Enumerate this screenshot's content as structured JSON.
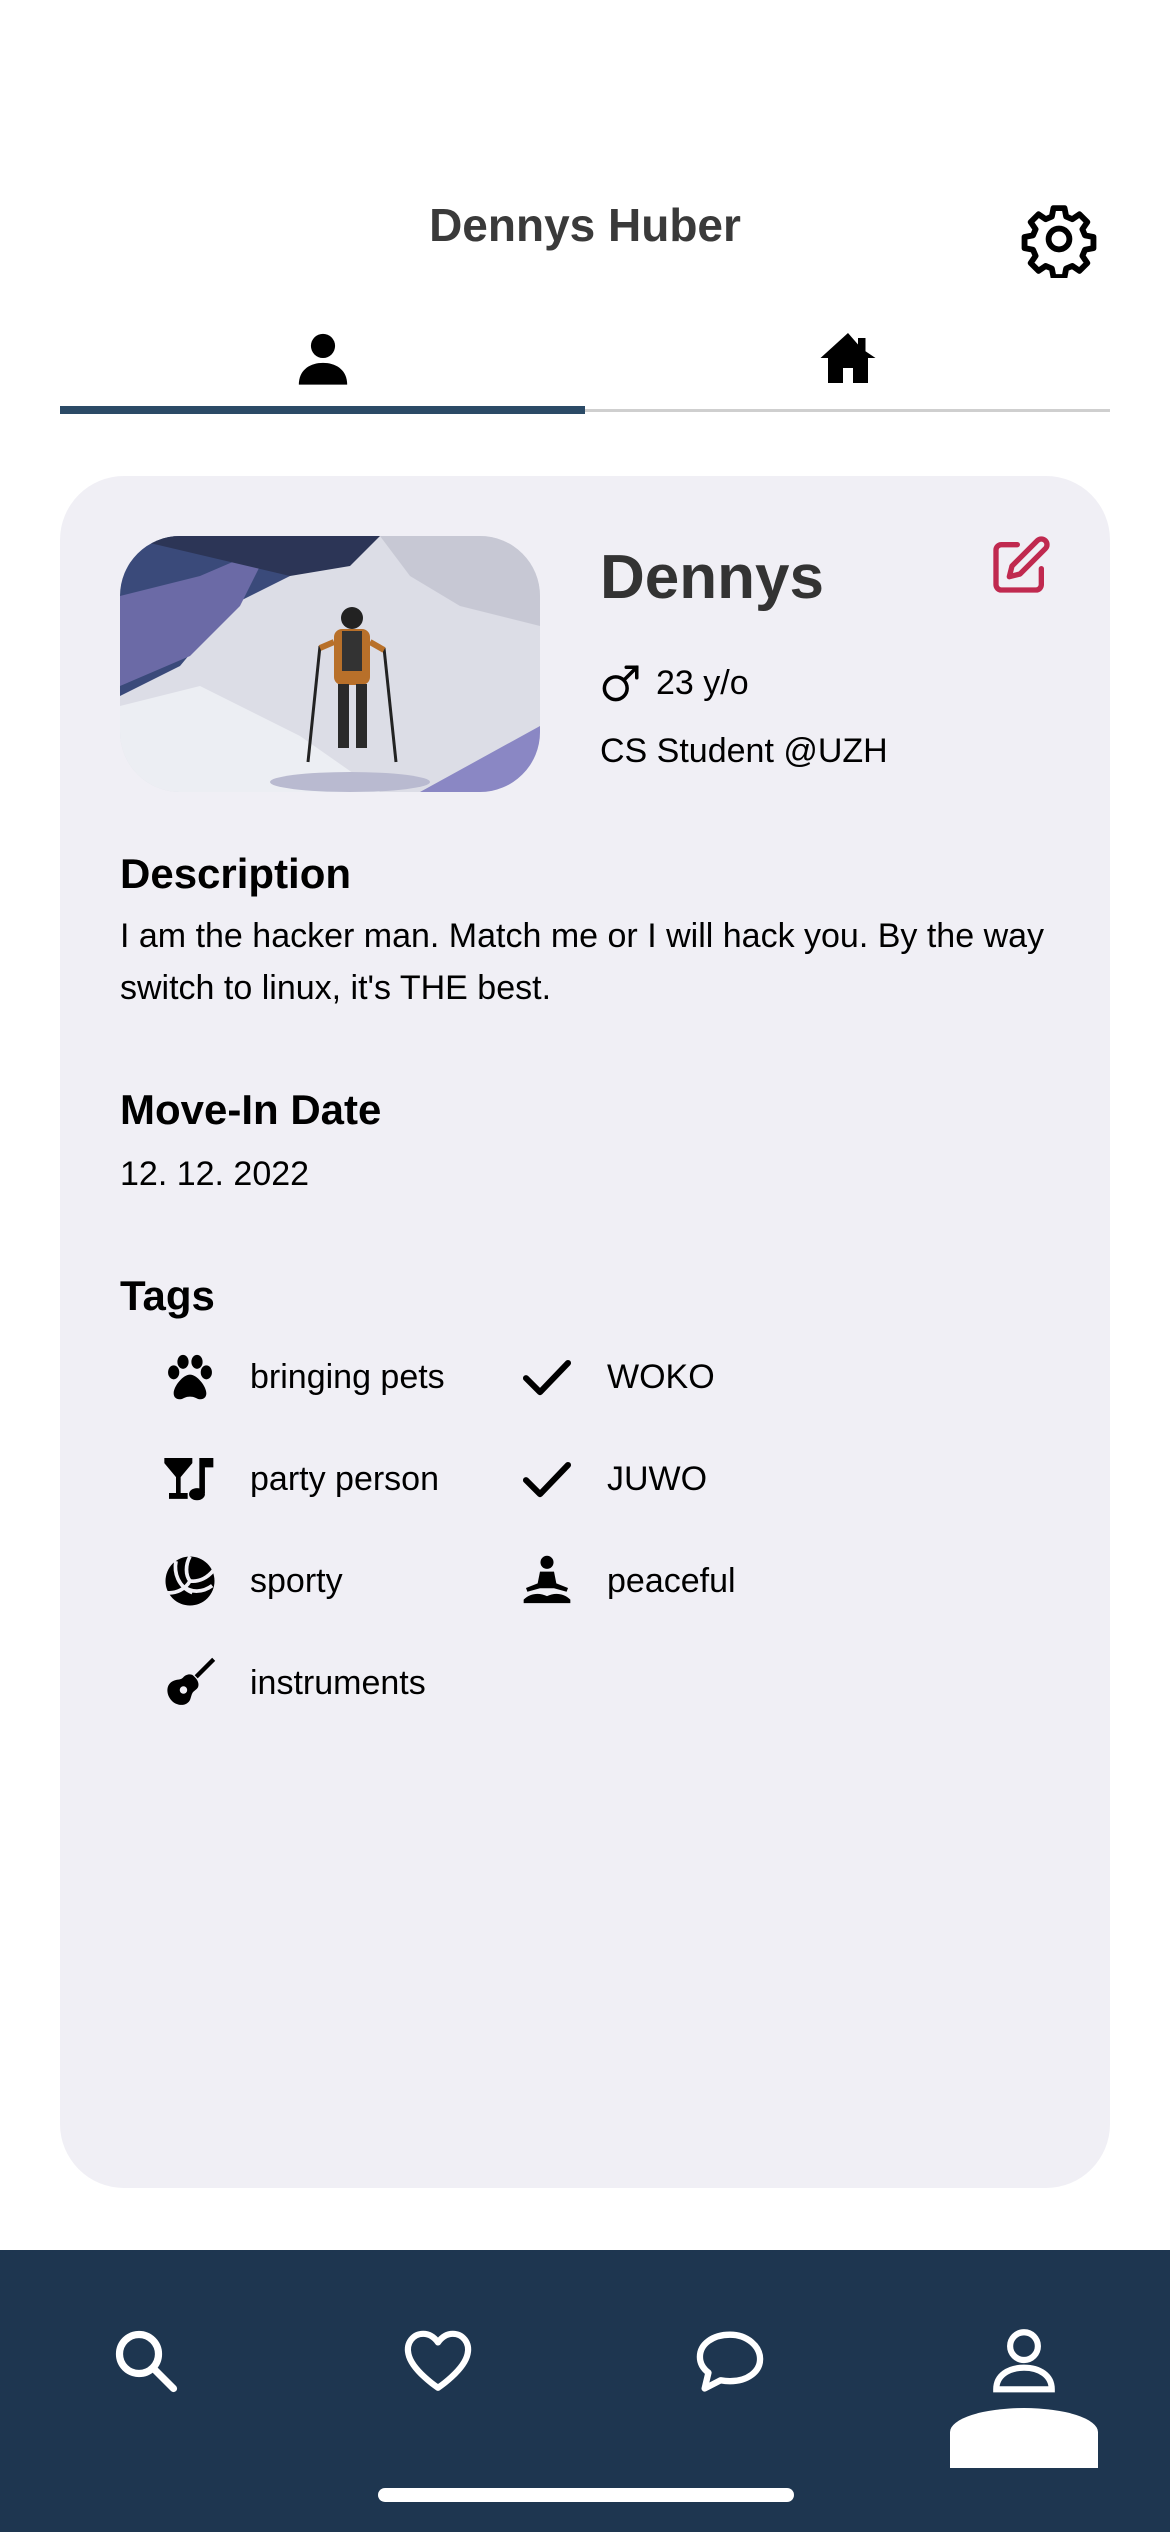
{
  "header": {
    "title": "Dennys Huber"
  },
  "tabs": [
    {
      "name": "profile",
      "icon": "person-icon",
      "active": true
    },
    {
      "name": "home",
      "icon": "home-icon",
      "active": false
    }
  ],
  "profile": {
    "name": "Dennys",
    "age": "23 y/o",
    "gender_icon": "male-icon",
    "occupation": "CS Student @UZH"
  },
  "description": {
    "title": "Description",
    "text": "I am the hacker man. Match me or I will hack you. By the way switch to linux, it's THE best."
  },
  "move_in": {
    "title": "Move-In Date",
    "date": "12. 12. 2022"
  },
  "tags": {
    "title": "Tags",
    "items": [
      {
        "label": "bringing pets",
        "icon": "paw-icon"
      },
      {
        "label": "WOKO",
        "icon": "check-icon"
      },
      {
        "label": "party person",
        "icon": "cocktail-music-icon"
      },
      {
        "label": "JUWO",
        "icon": "check-icon"
      },
      {
        "label": "sporty",
        "icon": "volleyball-icon"
      },
      {
        "label": "peaceful",
        "icon": "meditation-icon"
      },
      {
        "label": "instruments",
        "icon": "guitar-icon"
      }
    ]
  },
  "bottom_nav": [
    {
      "name": "search",
      "icon": "search-icon"
    },
    {
      "name": "likes",
      "icon": "heart-icon"
    },
    {
      "name": "chat",
      "icon": "chat-icon"
    },
    {
      "name": "profile",
      "icon": "person-icon",
      "active": true
    }
  ],
  "colors": {
    "accent": "#2b4a66",
    "nav_bg": "#1e3650",
    "card_bg": "#f0eff5",
    "edit": "#c0294f"
  }
}
